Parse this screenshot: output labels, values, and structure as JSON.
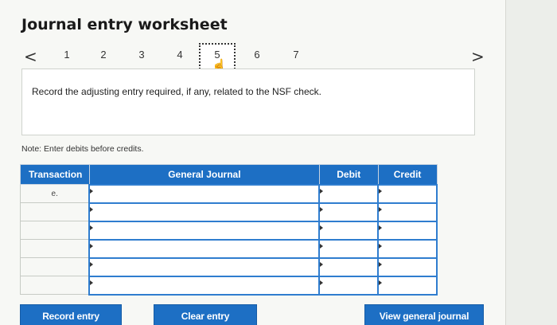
{
  "header": {
    "title": "Journal entry worksheet"
  },
  "pager": {
    "prev_arrow": "<",
    "next_arrow": ">",
    "pages": [
      "1",
      "2",
      "3",
      "4",
      "5",
      "6",
      "7"
    ],
    "current": "5",
    "cursor_glyph": "☝"
  },
  "instruction": {
    "text": "Record the adjusting entry required, if any, related to the NSF check."
  },
  "note": {
    "text": "Note: Enter debits before credits."
  },
  "table": {
    "headers": {
      "transaction": "Transaction",
      "journal": "General Journal",
      "debit": "Debit",
      "credit": "Credit"
    },
    "rows": [
      {
        "transaction": "e.",
        "account": "",
        "debit": "",
        "credit": ""
      },
      {
        "transaction": "",
        "account": "",
        "debit": "",
        "credit": ""
      },
      {
        "transaction": "",
        "account": "",
        "debit": "",
        "credit": ""
      },
      {
        "transaction": "",
        "account": "",
        "debit": "",
        "credit": ""
      },
      {
        "transaction": "",
        "account": "",
        "debit": "",
        "credit": ""
      },
      {
        "transaction": "",
        "account": "",
        "debit": "",
        "credit": ""
      }
    ]
  },
  "buttons": {
    "record": "Record entry",
    "clear": "Clear entry",
    "view": "View general journal"
  },
  "colors": {
    "accent": "#1d6fc4",
    "field_border": "#2f7dcf",
    "panel_bg": "#f7f8f5"
  }
}
